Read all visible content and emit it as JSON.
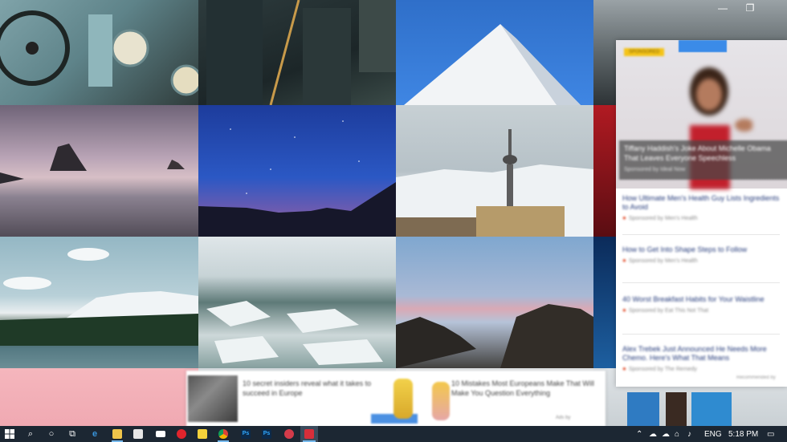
{
  "window": {
    "minimize_glyph": "—",
    "restore_glyph": "❐"
  },
  "ad_panel": {
    "badge": "SPONSORED",
    "hero_caption": "Tiffany Haddish's Joke About Michelle Obama That Leaves Everyone Speechless",
    "hero_source": "Sponsored by Ideal Now",
    "items": [
      {
        "headline": "How Ultimate Men's Health Guy Lists Ingredients to Avoid",
        "source": "Sponsored by Men's Health"
      },
      {
        "headline": "How to Get Into Shape Steps to Follow",
        "source": "Sponsored by Men's Health"
      },
      {
        "headline": "40 Worst Breakfast Habits for Your Waistline",
        "source": "Sponsored by Eat This Not That"
      },
      {
        "headline": "Alex Trebek Just Announced He Needs More Chemo. Here's What That Means",
        "source": "Sponsored by The Remedy"
      }
    ],
    "footer": "Recommended by"
  },
  "banner": {
    "left_text": "10 secret insiders reveal what it takes to succeed in Europe",
    "right_text": "10 Mistakes Most Europeans Make That Will Make You Question Everything",
    "meta": "Ads by"
  },
  "taskbar": {
    "start_icon": "windows-logo",
    "search_glyph": "⌕",
    "cortana_glyph": "○",
    "taskview_glyph": "⧉",
    "tray_expand_glyph": "⌃",
    "language": "ENG",
    "time": "5:18 PM",
    "notification_glyph": "▭"
  }
}
